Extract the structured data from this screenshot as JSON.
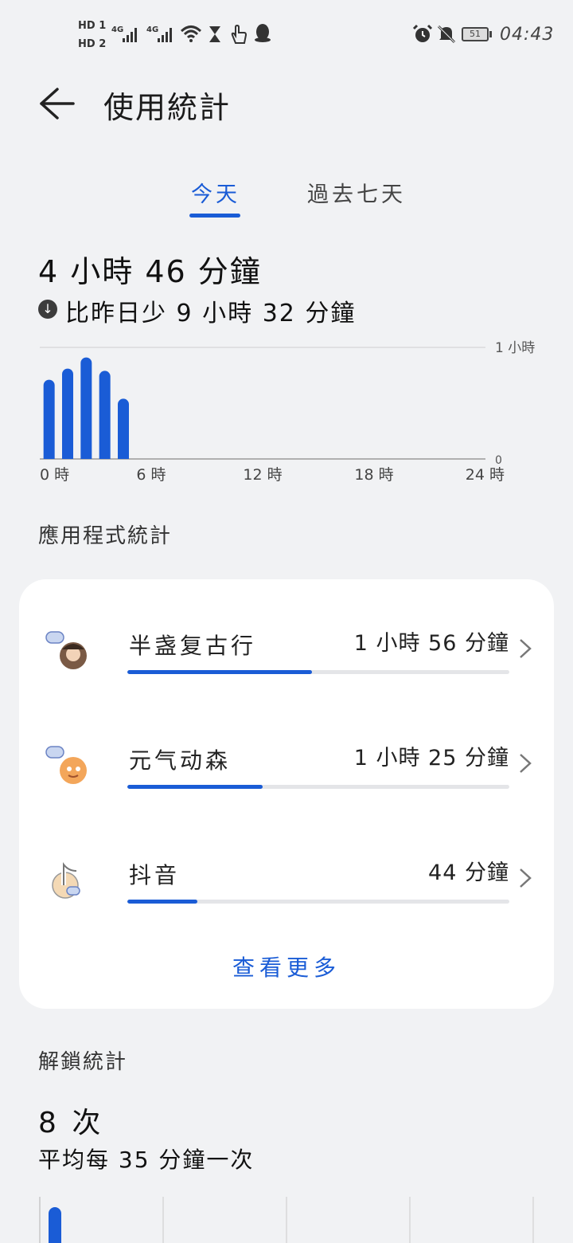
{
  "status_bar": {
    "hd1": "HD 1",
    "hd2": "HD 2",
    "net1": "4G",
    "net2": "4G",
    "battery": "51",
    "time": "04:43",
    "icons": [
      "signal-icon",
      "signal-icon",
      "wifi-icon",
      "hourglass-icon",
      "hand-icon",
      "qq-icon",
      "alarm-icon",
      "mute-icon",
      "battery-icon"
    ]
  },
  "header": {
    "title": "使用統計"
  },
  "tabs": [
    {
      "label": "今天",
      "active": true
    },
    {
      "label": "過去七天",
      "active": false
    }
  ],
  "summary": {
    "total": "4 小時 46 分鐘",
    "comparison": "比昨日少 9 小時 32 分鐘"
  },
  "hourly_chart": {
    "chart_data": {
      "type": "bar",
      "x": [
        0,
        1,
        2,
        3,
        4
      ],
      "values": [
        0.71,
        0.81,
        0.91,
        0.79,
        0.54
      ],
      "ylim": [
        0,
        1
      ],
      "y_unit": "小時",
      "y_tick_labels": [
        "1 小時",
        "0"
      ],
      "x_tick_labels": [
        "0 時",
        "6 時",
        "12 時",
        "18 時",
        "24 時"
      ],
      "xlim": [
        0,
        24
      ],
      "grid": true,
      "bar_color": "#1a5cd6"
    }
  },
  "apps_section": {
    "heading": "應用程式統計",
    "items": [
      {
        "name": "半盏复古行",
        "time": "1 小時 56 分鐘",
        "minutes": 116,
        "icon": "game-app-icon-1"
      },
      {
        "name": "元气动森",
        "time": "1 小時 25 分鐘",
        "minutes": 85,
        "icon": "game-app-icon-2"
      },
      {
        "name": "抖音",
        "time": "44 分鐘",
        "minutes": 44,
        "icon": "douyin-app-icon"
      }
    ],
    "view_more": "查看更多"
  },
  "unlock_section": {
    "heading": "解鎖統計",
    "count": "8 次",
    "average": "平均每 35 分鐘一次"
  },
  "colors": {
    "accent": "#1a5cd6",
    "background": "#f1f2f4",
    "card": "#ffffff"
  }
}
